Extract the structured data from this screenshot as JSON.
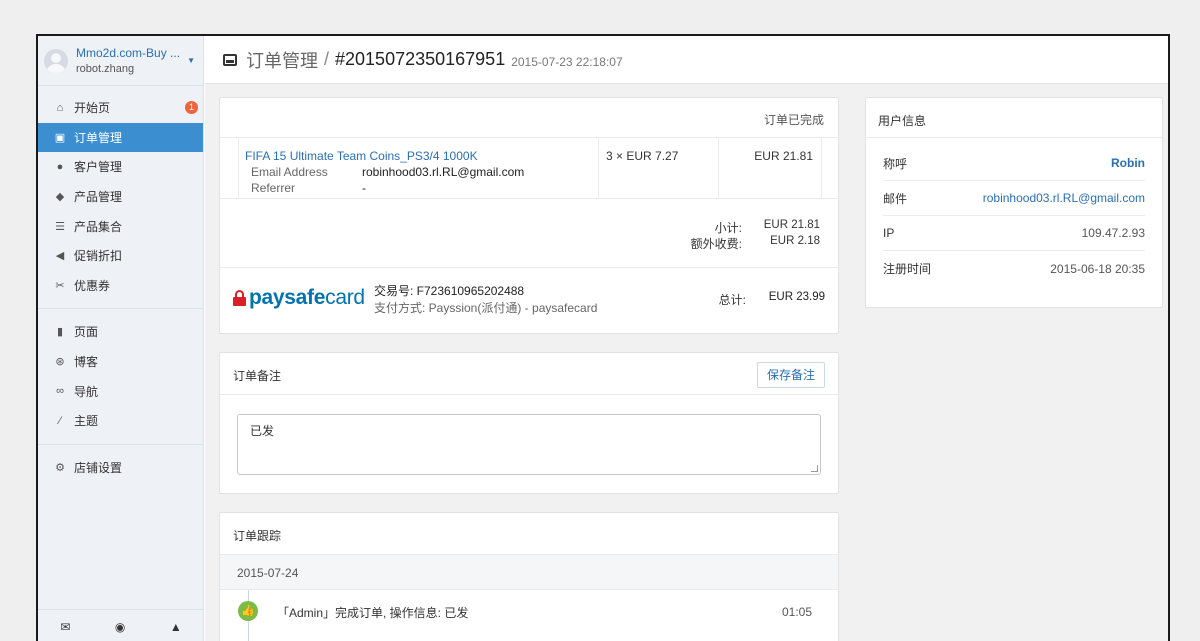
{
  "account": {
    "shop_name": "Mmo2d.com-Buy ...",
    "user_name": "robot.zhang"
  },
  "nav": {
    "items": [
      {
        "label": "开始页",
        "icon": "home-icon",
        "badge": "1"
      },
      {
        "label": "订单管理",
        "icon": "inbox-icon",
        "active": true
      },
      {
        "label": "客户管理",
        "icon": "user-icon"
      },
      {
        "label": "产品管理",
        "icon": "tags-icon"
      },
      {
        "label": "产品集合",
        "icon": "list-icon"
      },
      {
        "label": "促销折扣",
        "icon": "bullhorn-icon"
      },
      {
        "label": "优惠券",
        "icon": "scissors-icon"
      }
    ],
    "items2": [
      {
        "label": "页面",
        "icon": "file-icon"
      },
      {
        "label": "博客",
        "icon": "wordpress-icon"
      },
      {
        "label": "导航",
        "icon": "link-icon"
      },
      {
        "label": "主题",
        "icon": "magic-wand-icon"
      }
    ],
    "items3": [
      {
        "label": "店铺设置",
        "icon": "gear-icon"
      }
    ],
    "bottom_icons": [
      "wechat-icon",
      "eye-icon",
      "bell-icon"
    ]
  },
  "topbar": {
    "section": "订单管理",
    "separator": "/",
    "order_number": "#2015072350167951",
    "timestamp": "2015-07-23 22:18:07"
  },
  "order": {
    "status": "订单已完成",
    "item": {
      "title": "FIFA 15 Ultimate Team Coins_PS3/4 1000K",
      "attrs": [
        {
          "label": "Email Address",
          "value": "robinhood03.rl.RL@gmail.com"
        },
        {
          "label": "Referrer",
          "value": "-"
        }
      ],
      "quantity": "3 × EUR 7.27",
      "line_total": "EUR 21.81"
    },
    "subtotal_label": "小计:",
    "subtotal_value": "EUR 21.81",
    "fee_label": "额外收费:",
    "fee_value": "EUR 2.18",
    "payment": {
      "logo_part1": "paysafe",
      "logo_part2": "card",
      "transaction": "交易号: F723610965202488",
      "method": "支付方式:   Payssion(派付通) - paysafecard",
      "total_label": "总计:",
      "total_value": "EUR 23.99"
    }
  },
  "note": {
    "title": "订单备注",
    "save_label": "保存备注",
    "text": "已发"
  },
  "tracking": {
    "title": "订单跟踪",
    "date": "2015-07-24",
    "events": [
      {
        "text": "「Admin」完成订单, 操作信息: 已发",
        "time": "01:05"
      }
    ]
  },
  "user_info": {
    "title": "用户信息",
    "rows": [
      {
        "label": "称呼",
        "value": "Robin"
      },
      {
        "label": "邮件",
        "value": "robinhood03.rl.RL@gmail.com"
      },
      {
        "label": "IP",
        "value": "109.47.2.93"
      },
      {
        "label": "注册时间",
        "value": "2015-06-18 20:35"
      }
    ]
  },
  "colors": {
    "accent": "#3b8fd0",
    "link": "#2a6fb4",
    "badge": "#f0633e",
    "success": "#7cbb45",
    "paysafe_red": "#d92027",
    "paysafe_blue": "#0073b1"
  }
}
